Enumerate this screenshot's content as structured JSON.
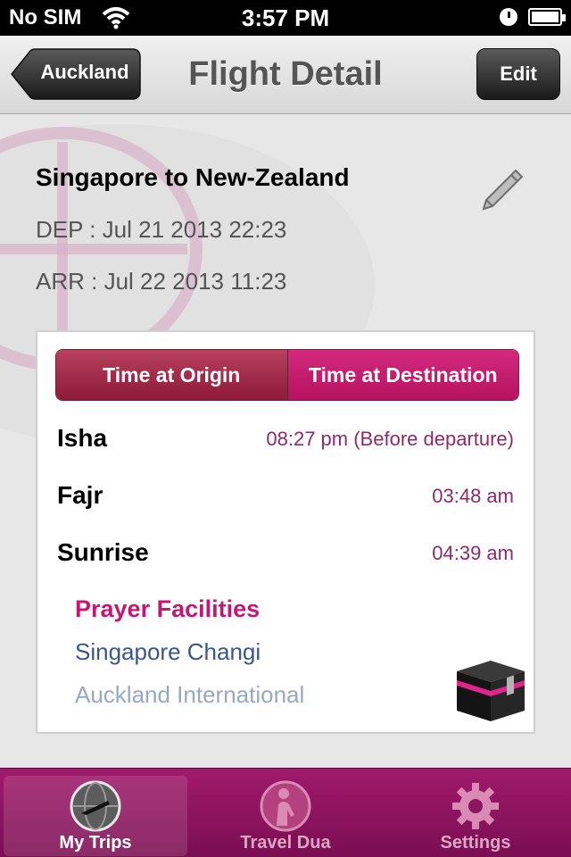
{
  "status_bar": {
    "carrier": "No SIM",
    "time": "3:57 PM",
    "icons": [
      "wifi-icon",
      "alarm-icon",
      "battery-icon"
    ]
  },
  "nav": {
    "back_label": "Auckland",
    "title": "Flight Detail",
    "edit_label": "Edit"
  },
  "trip": {
    "title": "Singapore to New-Zealand",
    "departure": "DEP : Jul 21 2013 22:23",
    "arrival": "ARR : Jul 22 2013 11:23"
  },
  "segmented": {
    "options": [
      "Time at Origin",
      "Time at Destination"
    ],
    "selected": "Time at Origin"
  },
  "prayers": [
    {
      "name": "Isha",
      "time": "08:27 pm (Before departure)"
    },
    {
      "name": "Fajr",
      "time": "03:48 am"
    },
    {
      "name": "Sunrise",
      "time": "04:39 am"
    }
  ],
  "facilities": {
    "title": "Prayer Facilities",
    "items": [
      "Singapore Changi",
      "Auckland International"
    ]
  },
  "tabs": [
    {
      "label": "My Trips",
      "icon": "globe-plane-icon",
      "active": true
    },
    {
      "label": "Travel Dua",
      "icon": "praying-person-icon",
      "active": false
    },
    {
      "label": "Settings",
      "icon": "gear-icon",
      "active": false
    }
  ],
  "colors": {
    "accent": "#c41775",
    "segment_origin": "#9a2445",
    "segment_destination": "#c8186f",
    "prayer_time": "#8e2a6a",
    "tabbar": "#8c1460"
  }
}
